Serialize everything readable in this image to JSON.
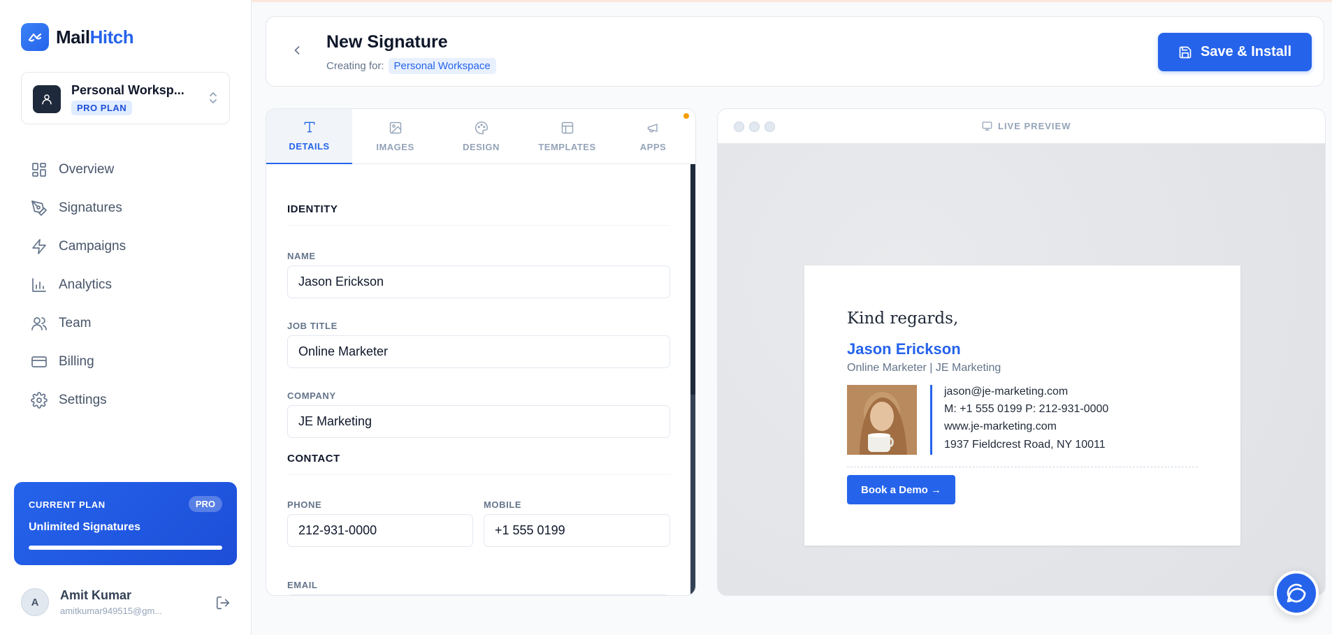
{
  "brand": {
    "name_prefix": "Mail",
    "name_accent": "Hitch"
  },
  "workspace": {
    "name": "Personal Worksp...",
    "plan": "PRO PLAN"
  },
  "nav": [
    {
      "label": "Overview",
      "icon": "grid-icon"
    },
    {
      "label": "Signatures",
      "icon": "pen-tool-icon"
    },
    {
      "label": "Campaigns",
      "icon": "zap-icon"
    },
    {
      "label": "Analytics",
      "icon": "bar-chart-icon"
    },
    {
      "label": "Team",
      "icon": "users-icon"
    },
    {
      "label": "Billing",
      "icon": "credit-card-icon"
    },
    {
      "label": "Settings",
      "icon": "gear-icon"
    }
  ],
  "plan_card": {
    "label": "CURRENT PLAN",
    "badge": "PRO",
    "title": "Unlimited Signatures",
    "progress": 1.0
  },
  "user": {
    "initial": "A",
    "name": "Amit Kumar",
    "email": "amitkumar949515@gm..."
  },
  "header": {
    "title": "New Signature",
    "creating_for_label": "Creating for:",
    "workspace_chip": "Personal Workspace",
    "save_label": "Save & Install"
  },
  "tabs": [
    {
      "label": "DETAILS",
      "icon": "text-icon",
      "active": true
    },
    {
      "label": "IMAGES",
      "icon": "image-icon",
      "active": false
    },
    {
      "label": "DESIGN",
      "icon": "palette-icon",
      "active": false
    },
    {
      "label": "TEMPLATES",
      "icon": "layout-icon",
      "active": false
    },
    {
      "label": "APPS",
      "icon": "megaphone-icon",
      "active": false
    }
  ],
  "form": {
    "identity_title": "IDENTITY",
    "name_label": "NAME",
    "name_value": "Jason Erickson",
    "job_label": "JOB TITLE",
    "job_value": "Online Marketer",
    "company_label": "COMPANY",
    "company_value": "JE Marketing",
    "contact_title": "CONTACT",
    "phone_label": "PHONE",
    "phone_value": "212-931-0000",
    "mobile_label": "MOBILE",
    "mobile_value": "+1 555 0199",
    "email_label": "EMAIL"
  },
  "preview": {
    "label": "LIVE PREVIEW",
    "greeting": "Kind regards,",
    "name": "Jason Erickson",
    "role": "Online Marketer | JE Marketing",
    "email": "jason@je-marketing.com",
    "phones": "M: +1 555 0199 P: 212-931-0000",
    "website": "www.je-marketing.com",
    "address": "1937 Fieldcrest Road, NY 10011",
    "cta": "Book a Demo →"
  },
  "colors": {
    "accent": "#2563eb",
    "sidebar_bg": "#ffffff",
    "preview_bg": "#e2e4e8",
    "notification_dot": "#f59e0b"
  }
}
